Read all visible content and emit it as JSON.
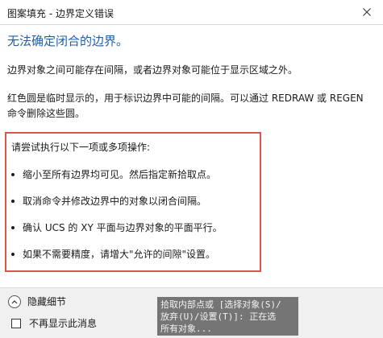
{
  "window": {
    "title": "图案填充 - 边界定义错误"
  },
  "heading": "无法确定闭合的边界。",
  "paragraphs": [
    "边界对象之间可能存在间隔，或者边界对象可能位于显示区域之外。",
    "红色圆是临时显示的，用于标识边界中可能的间隔。可以通过 REDRAW 或 REGEN 命令删除这些圆。"
  ],
  "actions": {
    "intro": "请尝试执行以下一项或多项操作:",
    "items": [
      "缩小至所有边界均可见。然后指定新拾取点。",
      "取消命令并修改边界中的对象以闭合间隔。",
      "确认 UCS 的 XY 平面与边界对象的平面平行。",
      "如果不需要精度，请增大\"允许的间隙\"设置。"
    ]
  },
  "footer": {
    "details_label": "隐藏细节",
    "dont_show_label": "不再显示此消息",
    "dont_show_checked": false
  },
  "command_tooltip": {
    "lines": [
      "拾取内部点或 [选择对象(S)/",
      "放弃(U)/设置(T)]: 正在选",
      "所有对象..."
    ]
  },
  "colors": {
    "heading": "#1e5fa8",
    "highlight_border": "#d9534f",
    "footer_bg": "#f0f0f0"
  }
}
